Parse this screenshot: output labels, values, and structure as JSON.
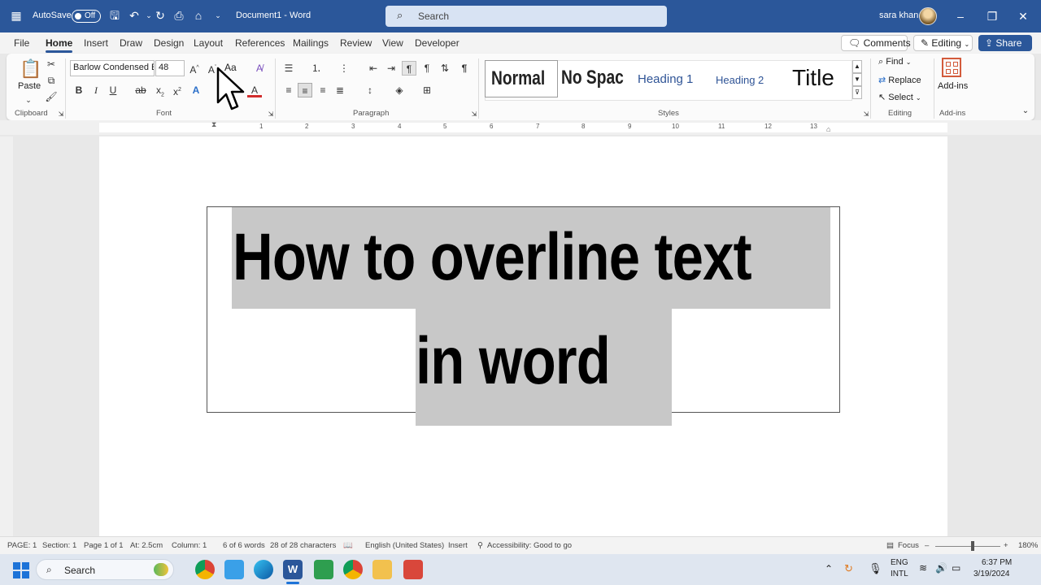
{
  "titlebar": {
    "autosave_label": "AutoSave",
    "autosave_state": "Off",
    "doc_title": "Document1  -  Word",
    "search_placeholder": "Search",
    "user_name": "sara khan"
  },
  "menu": {
    "tabs": [
      "File",
      "Home",
      "Insert",
      "Draw",
      "Design",
      "Layout",
      "References",
      "Mailings",
      "Review",
      "View",
      "Developer"
    ],
    "active": "Home",
    "comments_label": "Comments",
    "editing_label": "Editing",
    "share_label": "Share"
  },
  "ribbon": {
    "clipboard": {
      "paste_label": "Paste",
      "group_label": "Clipboard"
    },
    "font": {
      "font_name": "Barlow Condensed E",
      "font_size": "48",
      "change_case": "Aa",
      "group_label": "Font"
    },
    "paragraph": {
      "group_label": "Paragraph"
    },
    "styles": {
      "items": [
        "Normal",
        "No Spac",
        "Heading 1",
        "Heading 2",
        "Title"
      ],
      "selected": "Normal",
      "group_label": "Styles"
    },
    "editing": {
      "find_label": "Find",
      "replace_label": "Replace",
      "select_label": "Select",
      "group_label": "Editing"
    },
    "addins": {
      "label": "Add-ins",
      "group_label": "Add-ins"
    }
  },
  "ruler": {
    "marks": [
      "1",
      "1",
      "2",
      "3",
      "4",
      "5",
      "6",
      "7",
      "8",
      "9",
      "10",
      "11",
      "12",
      "13"
    ]
  },
  "document": {
    "line1": "How to overline text",
    "line2": "in word"
  },
  "statusbar": {
    "page": "PAGE: 1",
    "section": "Section: 1",
    "page_of": "Page 1 of 1",
    "at": "At: 2.5cm",
    "column": "Column: 1",
    "words": "6 of 6 words",
    "characters": "28 of 28 characters",
    "language": "English (United States)",
    "mode": "Insert",
    "accessibility": "Accessibility: Good to go",
    "focus": "Focus",
    "zoom": "180%"
  },
  "taskbar": {
    "search_label": "Search",
    "lang_line1": "ENG",
    "lang_line2": "INTL",
    "time": "6:37 PM",
    "date": "3/19/2024"
  },
  "colors": {
    "word_blue": "#2b579a",
    "selection_gray": "#c8c8c8"
  }
}
